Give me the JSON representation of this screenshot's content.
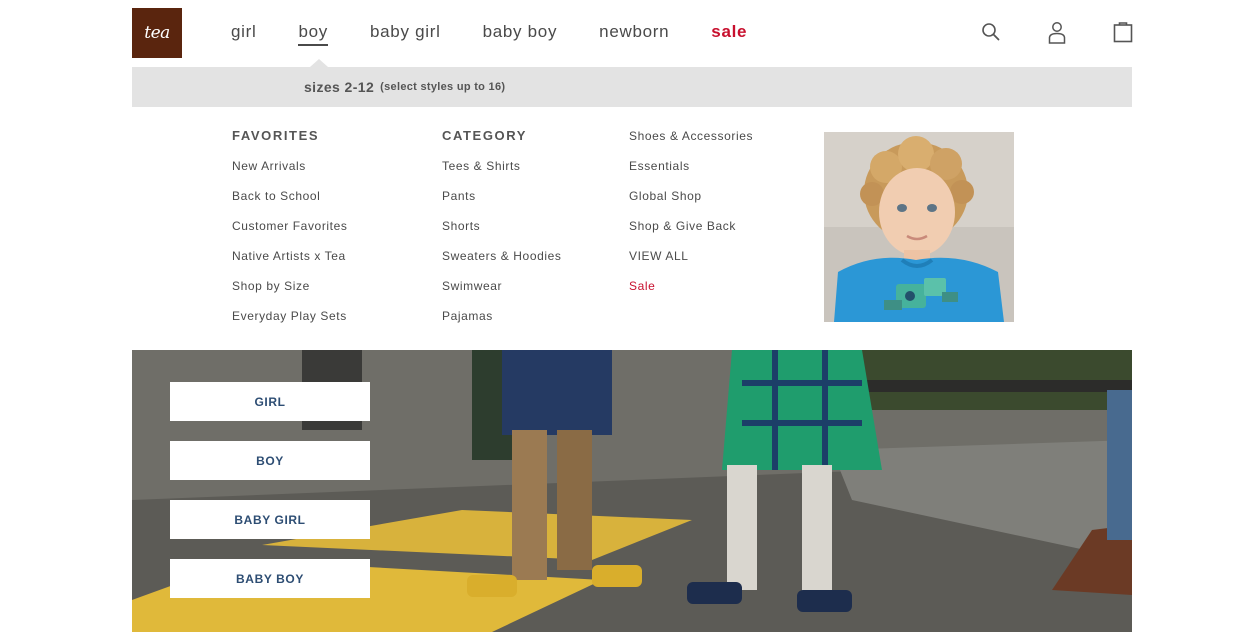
{
  "brand": {
    "logo_text": "tea",
    "color": "#5a250e"
  },
  "nav": {
    "items": [
      {
        "label": "girl"
      },
      {
        "label": "boy",
        "active": true
      },
      {
        "label": "baby girl"
      },
      {
        "label": "baby boy"
      },
      {
        "label": "newborn"
      },
      {
        "label": "sale",
        "highlight": "#c8102e"
      }
    ]
  },
  "utility": {
    "search": "search-icon",
    "account": "account-icon",
    "cart": "shopping-bag-icon"
  },
  "size_bar": {
    "main": "sizes 2-12",
    "note": "(select styles up to 16)"
  },
  "menu": {
    "favorites": {
      "heading": "FAVORITES",
      "items": [
        "New Arrivals",
        "Back to School",
        "Customer Favorites",
        "Native Artists x Tea",
        "Shop by Size",
        "Everyday Play Sets"
      ]
    },
    "category": {
      "heading": "CATEGORY",
      "items": [
        "Tees & Shirts",
        "Pants",
        "Shorts",
        "Sweaters & Hoodies",
        "Swimwear",
        "Pajamas"
      ]
    },
    "more": {
      "items": [
        "Shoes & Accessories",
        "Essentials",
        "Global Shop",
        "Shop & Give Back",
        "VIEW ALL",
        "Sale"
      ]
    }
  },
  "hero": {
    "buttons": [
      "GIRL",
      "BOY",
      "BABY GIRL",
      "BABY BOY"
    ],
    "button_text_color": "#2d4d73"
  }
}
